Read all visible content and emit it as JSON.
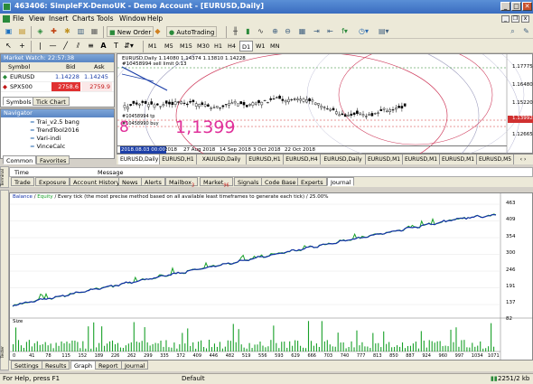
{
  "window": {
    "title": "463406: SimpleFX-DemoUK - Demo Account - [EURUSD,Daily]",
    "min": "_",
    "max": "□",
    "close": "✕",
    "mdi_min": "_",
    "mdi_restore": "❐",
    "mdi_close": "x"
  },
  "menu": [
    "File",
    "View",
    "Insert",
    "Charts",
    "Tools",
    "Window",
    "Help"
  ],
  "toolbar": {
    "new_order": "New Order",
    "autotrading": "AutoTrading",
    "timeframes": [
      "M1",
      "M5",
      "M15",
      "M30",
      "H1",
      "H4",
      "D1",
      "W1",
      "MN"
    ],
    "active_timeframe": "D1"
  },
  "market_watch": {
    "title": "Market Watch: 22:57:38",
    "columns": [
      "Symbol",
      "Bid",
      "Ask"
    ],
    "rows": [
      {
        "symbol": "EURUSD",
        "bid": "1.14228",
        "ask": "1.14245",
        "color": "#1c3fa8"
      },
      {
        "symbol": "SPX500",
        "bid": "2758.6",
        "ask": "2759.9",
        "color": "#c01818"
      }
    ],
    "tabs": [
      "Symbols",
      "Tick Chart"
    ],
    "active_tab": "Symbols"
  },
  "navigator": {
    "title": "Navigator",
    "items": [
      "Trai_v2.5 bang",
      "TrendTool2016",
      "Vari-indi",
      "VinceCalc"
    ],
    "tabs": [
      "Common",
      "Favorites"
    ],
    "active_tab": "Common"
  },
  "chart": {
    "header": "EURUSD,Daily  1.14080 1.14374 1.13810 1.14228",
    "sell_limit_label": "#10458994 sell limit 0.13",
    "order_label_a": "#10458994 tp",
    "order_label_b": "#10458990 buy",
    "big_price": "1,1399",
    "big_prefix": "8",
    "price_ticks": [
      "1.17775",
      "1.16480",
      "1.15220",
      "1.13992",
      "1.12665"
    ],
    "highlight_price": "1.13992",
    "date_ticks": [
      "2018.08.03 00:00",
      "2018",
      "27 Aug 2018",
      "14 Sep 2018",
      "3 Oct 2018",
      "22 Oct 2018"
    ],
    "tabs": [
      "EURUSD,Daily",
      "EURUSD,H1",
      "XAUUSD,Daily",
      "EURUSD,H1",
      "EURUSD,H4",
      "EURUSD,Daily",
      "EURUSD,M1",
      "EURUSD,M1",
      "EURUSD,M1",
      "EURUSD,M5"
    ],
    "active_tab": "EURUSD,Daily",
    "tab_arrows": "‹ ›"
  },
  "terminal": {
    "columns": [
      "Time",
      "Message"
    ],
    "tabs": [
      {
        "label": "Trade",
        "badge": ""
      },
      {
        "label": "Exposure",
        "badge": ""
      },
      {
        "label": "Account History",
        "badge": ""
      },
      {
        "label": "News",
        "badge": ""
      },
      {
        "label": "Alerts",
        "badge": ""
      },
      {
        "label": "Mailbox",
        "badge": "3"
      },
      {
        "label": "Market",
        "badge": "96"
      },
      {
        "label": "Signals",
        "badge": ""
      },
      {
        "label": "Code Base",
        "badge": ""
      },
      {
        "label": "Experts",
        "badge": ""
      },
      {
        "label": "Journal",
        "badge": ""
      }
    ],
    "active_tab": "Journal",
    "side_label": "Terminal"
  },
  "tester": {
    "legend_balance": "Balance",
    "legend_sep": "/",
    "legend_equity": "Equity",
    "legend_rest": "/ Every tick (the most precise method based on all available least timeframes to generate each tick) / 25.00%",
    "y_ticks": [
      "463",
      "409",
      "354",
      "300",
      "246",
      "191",
      "137",
      "82"
    ],
    "size_label": "Size",
    "x_ticks": [
      "0",
      "41",
      "78",
      "115",
      "152",
      "189",
      "226",
      "262",
      "299",
      "335",
      "372",
      "409",
      "446",
      "482",
      "519",
      "556",
      "593",
      "629",
      "666",
      "703",
      "740",
      "777",
      "813",
      "850",
      "887",
      "924",
      "960",
      "997",
      "1034",
      "1071"
    ],
    "tabs": [
      "Settings",
      "Results",
      "Graph",
      "Report",
      "Journal"
    ],
    "active_tab": "Graph",
    "side_label": "Tester",
    "balance_color": "#1230a8",
    "equity_color": "#18a028",
    "size_color": "#18a028"
  },
  "status": {
    "help": "For Help, press F1",
    "profile": "Default",
    "traffic": "2251/2 kb"
  }
}
